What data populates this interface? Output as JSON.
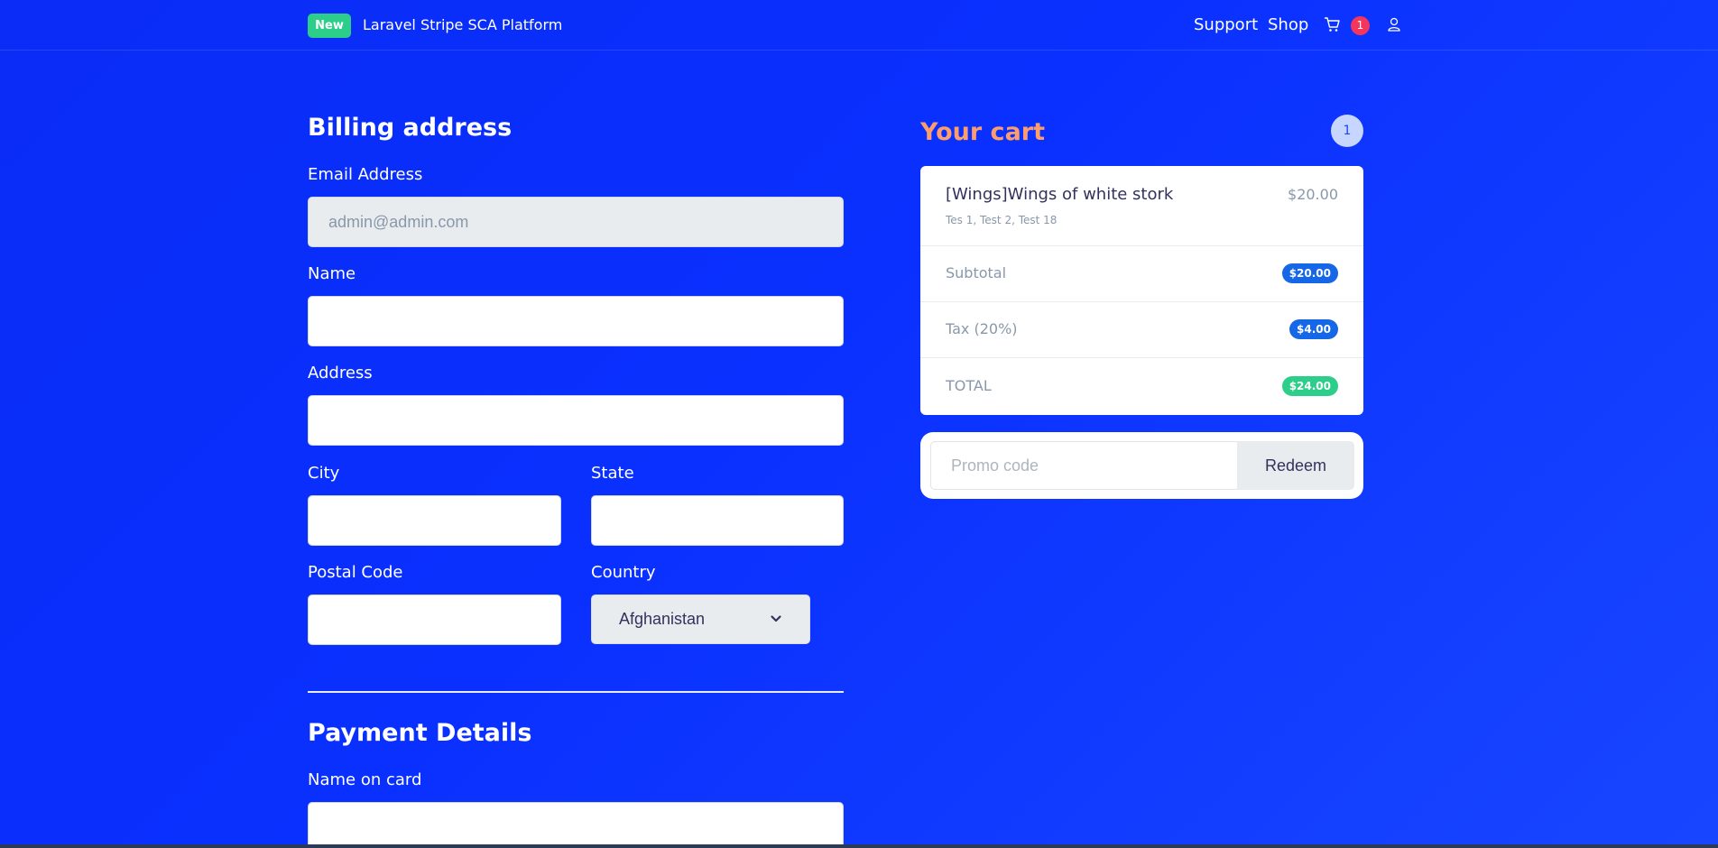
{
  "header": {
    "badge": "New",
    "brand": "Laravel Stripe SCA Platform",
    "nav_support": "Support",
    "nav_shop": "Shop",
    "cart_count": "1"
  },
  "billing": {
    "title": "Billing address",
    "email_label": "Email Address",
    "email_placeholder": "admin@admin.com",
    "name_label": "Name",
    "address_label": "Address",
    "city_label": "City",
    "state_label": "State",
    "postal_label": "Postal Code",
    "country_label": "Country",
    "country_value": "Afghanistan"
  },
  "payment": {
    "title": "Payment Details",
    "name_on_card_label": "Name on card"
  },
  "cart": {
    "title": "Your cart",
    "count": "1",
    "item_name": "[Wings]Wings of white stork",
    "item_variants": "Tes 1, Test 2, Test 18",
    "item_price": "$20.00",
    "subtotal_label": "Subtotal",
    "subtotal_value": "$20.00",
    "tax_label": "Tax (20%)",
    "tax_value": "$4.00",
    "total_label": "TOTAL",
    "total_value": "$24.00",
    "promo_placeholder": "Promo code",
    "redeem_label": "Redeem"
  },
  "colors": {
    "background": "#0a30ff",
    "cart_title": "#fb9d6d",
    "badge_green": "#2dce89",
    "pill_blue": "#1667e8",
    "notification_red": "#f5365c"
  },
  "icons": [
    "cart-icon",
    "user-icon",
    "chevron-down-icon"
  ]
}
